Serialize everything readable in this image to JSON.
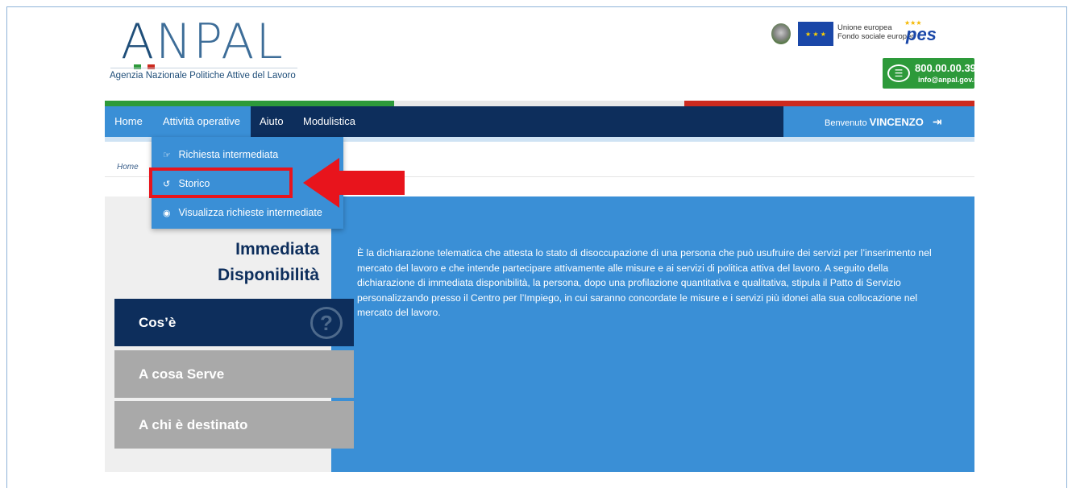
{
  "header": {
    "logo_text_a": "A",
    "logo_text_rest": "NPAL",
    "logo_subtitle": "Agenzia Nazionale Politiche Attive del Lavoro",
    "eu_line1": "Unione europea",
    "eu_line2": "Fondo sociale europeo",
    "pes_text": "pes",
    "phone": "800.00.00.39",
    "email": "info@anpal.gov.it"
  },
  "nav": {
    "home": "Home",
    "attivita": "Attività operative",
    "aiuto": "Aiuto",
    "modulistica": "Modulistica",
    "welcome_prefix": "Benvenuto",
    "welcome_user": "VINCENZO"
  },
  "dropdown": {
    "items": [
      {
        "label": "Richiesta intermediata",
        "icon": "handshake-icon"
      },
      {
        "label": "Storico",
        "icon": "history-icon"
      },
      {
        "label": "Visualizza richieste intermediate",
        "icon": "eye-icon"
      }
    ]
  },
  "breadcrumb": {
    "home": "Home"
  },
  "main": {
    "title_line1": "Immediata",
    "title_line2": "Disponibilità",
    "tabs": [
      {
        "label": "Cos’è"
      },
      {
        "label": "A cosa Serve"
      },
      {
        "label": "A chi è destinato"
      }
    ],
    "description": "È la dichiarazione telematica che attesta lo stato di disoccupazione di una persona che può usufruire dei servizi per l’inserimento nel mercato del lavoro e che intende partecipare attivamente alle misure e ai servizi di politica attiva del lavoro. A seguito della dichiarazione di immediata disponibilità, la persona, dopo una profilazione quantitativa e qualitativa, stipula il Patto di Servizio personalizzando presso il Centro per l’Impiego, in cui saranno concordate le misure e i servizi più idonei alla sua collocazione nel mercato del lavoro."
  },
  "colors": {
    "nav_dark": "#0d2e5c",
    "nav_active": "#3a8fd6",
    "highlight": "#e8141c",
    "green": "#2d9a3a",
    "red": "#cc2a1f"
  }
}
